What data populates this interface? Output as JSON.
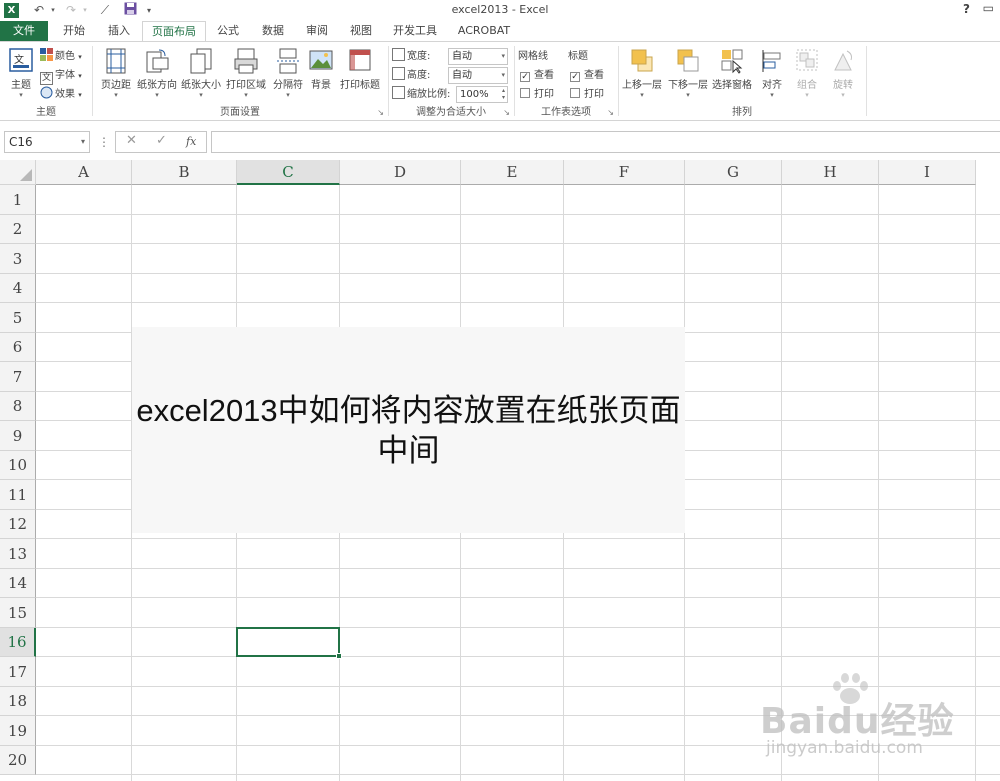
{
  "window": {
    "title": "excel2013 - Excel",
    "help_label": "?",
    "app_icon_label": "X"
  },
  "quick_access": {
    "save_icon": "save-icon",
    "undo_icon": "undo-icon",
    "redo_icon": "redo-icon"
  },
  "tabs": [
    {
      "label": "文件"
    },
    {
      "label": "开始"
    },
    {
      "label": "插入"
    },
    {
      "label": "页面布局"
    },
    {
      "label": "公式"
    },
    {
      "label": "数据"
    },
    {
      "label": "审阅"
    },
    {
      "label": "视图"
    },
    {
      "label": "开发工具"
    },
    {
      "label": "ACROBAT"
    }
  ],
  "ribbon": {
    "theme_group": {
      "label": "主题",
      "theme_button": "主题",
      "colors": "颜色",
      "fonts": "字体",
      "effects": "效果"
    },
    "page_setup": {
      "label": "页面设置",
      "margins": "页边距",
      "orientation": "纸张方向",
      "size": "纸张大小",
      "print_area": "打印区域",
      "breaks": "分隔符",
      "background": "背景",
      "print_titles": "打印标题"
    },
    "scale_to_fit": {
      "label": "调整为合适大小",
      "width_label": "宽度:",
      "width_value": "自动",
      "height_label": "高度:",
      "height_value": "自动",
      "scale_label": "缩放比例:",
      "scale_value": "100%"
    },
    "sheet_options": {
      "label": "工作表选项",
      "gridlines": "网格线",
      "headings": "标题",
      "view": "查看",
      "print": "打印"
    },
    "arrange": {
      "label": "排列",
      "bring_forward": "上移一层",
      "send_backward": "下移一层",
      "selection_pane": "选择窗格",
      "align": "对齐",
      "group": "组合",
      "rotate": "旋转"
    }
  },
  "formula_bar": {
    "name_box": "C16",
    "cancel": "✕",
    "enter": "✓",
    "fx": "fx",
    "formula": ""
  },
  "columns": [
    "A",
    "B",
    "C",
    "D",
    "E",
    "F",
    "G",
    "H",
    "I"
  ],
  "rows": [
    "1",
    "2",
    "3",
    "4",
    "5",
    "6",
    "7",
    "8",
    "9",
    "10",
    "11",
    "12",
    "13",
    "14",
    "15",
    "16",
    "17",
    "18",
    "19",
    "20"
  ],
  "selected_cell": {
    "column": "C",
    "row": "16"
  },
  "overlay_text": "excel2013中如何将内容放置在纸张页面中间",
  "watermark": {
    "logo": "Baidu经验",
    "url": "jingyan.baidu.com"
  },
  "colors": {
    "accent": "#217346",
    "ribbon_border": "#d4d4d4",
    "header_bg": "#f3f3f3"
  }
}
